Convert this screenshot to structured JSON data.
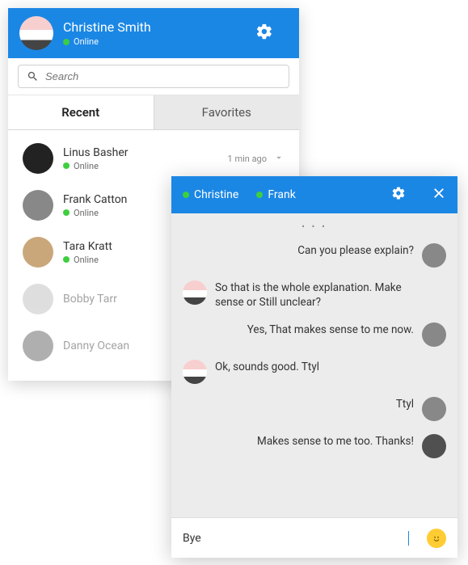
{
  "main": {
    "user": {
      "name": "Christine Smith",
      "status": "Online"
    },
    "search_placeholder": "Search",
    "tabs": {
      "recent": "Recent",
      "favorites": "Favorites"
    },
    "contacts": [
      {
        "name": "Linus Basher",
        "status": "Online",
        "meta": "1 min ago",
        "online": true,
        "faded": false
      },
      {
        "name": "Frank Catton",
        "status": "Online",
        "meta": "",
        "online": true,
        "faded": false
      },
      {
        "name": "Tara Kratt",
        "status": "Online",
        "meta": "",
        "online": true,
        "faded": false
      },
      {
        "name": "Bobby Tarr",
        "status": "",
        "meta": "",
        "online": false,
        "faded": true
      },
      {
        "name": "Danny Ocean",
        "status": "",
        "meta": "",
        "online": false,
        "faded": true
      }
    ]
  },
  "chat": {
    "participants": [
      {
        "name": "Christine"
      },
      {
        "name": "Frank"
      }
    ],
    "messages": [
      {
        "side": "right",
        "who": "frank",
        "text": "Can you please explain?"
      },
      {
        "side": "left",
        "who": "christine",
        "text": "So that is the whole explanation. Make sense or Still unclear?"
      },
      {
        "side": "right",
        "who": "frank",
        "text": "Yes, That makes sense to me now."
      },
      {
        "side": "left",
        "who": "christine",
        "text": "Ok, sounds good. Ttyl"
      },
      {
        "side": "right",
        "who": "frank",
        "text": "Ttyl"
      },
      {
        "side": "right",
        "who": "danny",
        "text": "Makes sense to me too. Thanks!"
      }
    ],
    "input_value": "Bye"
  }
}
